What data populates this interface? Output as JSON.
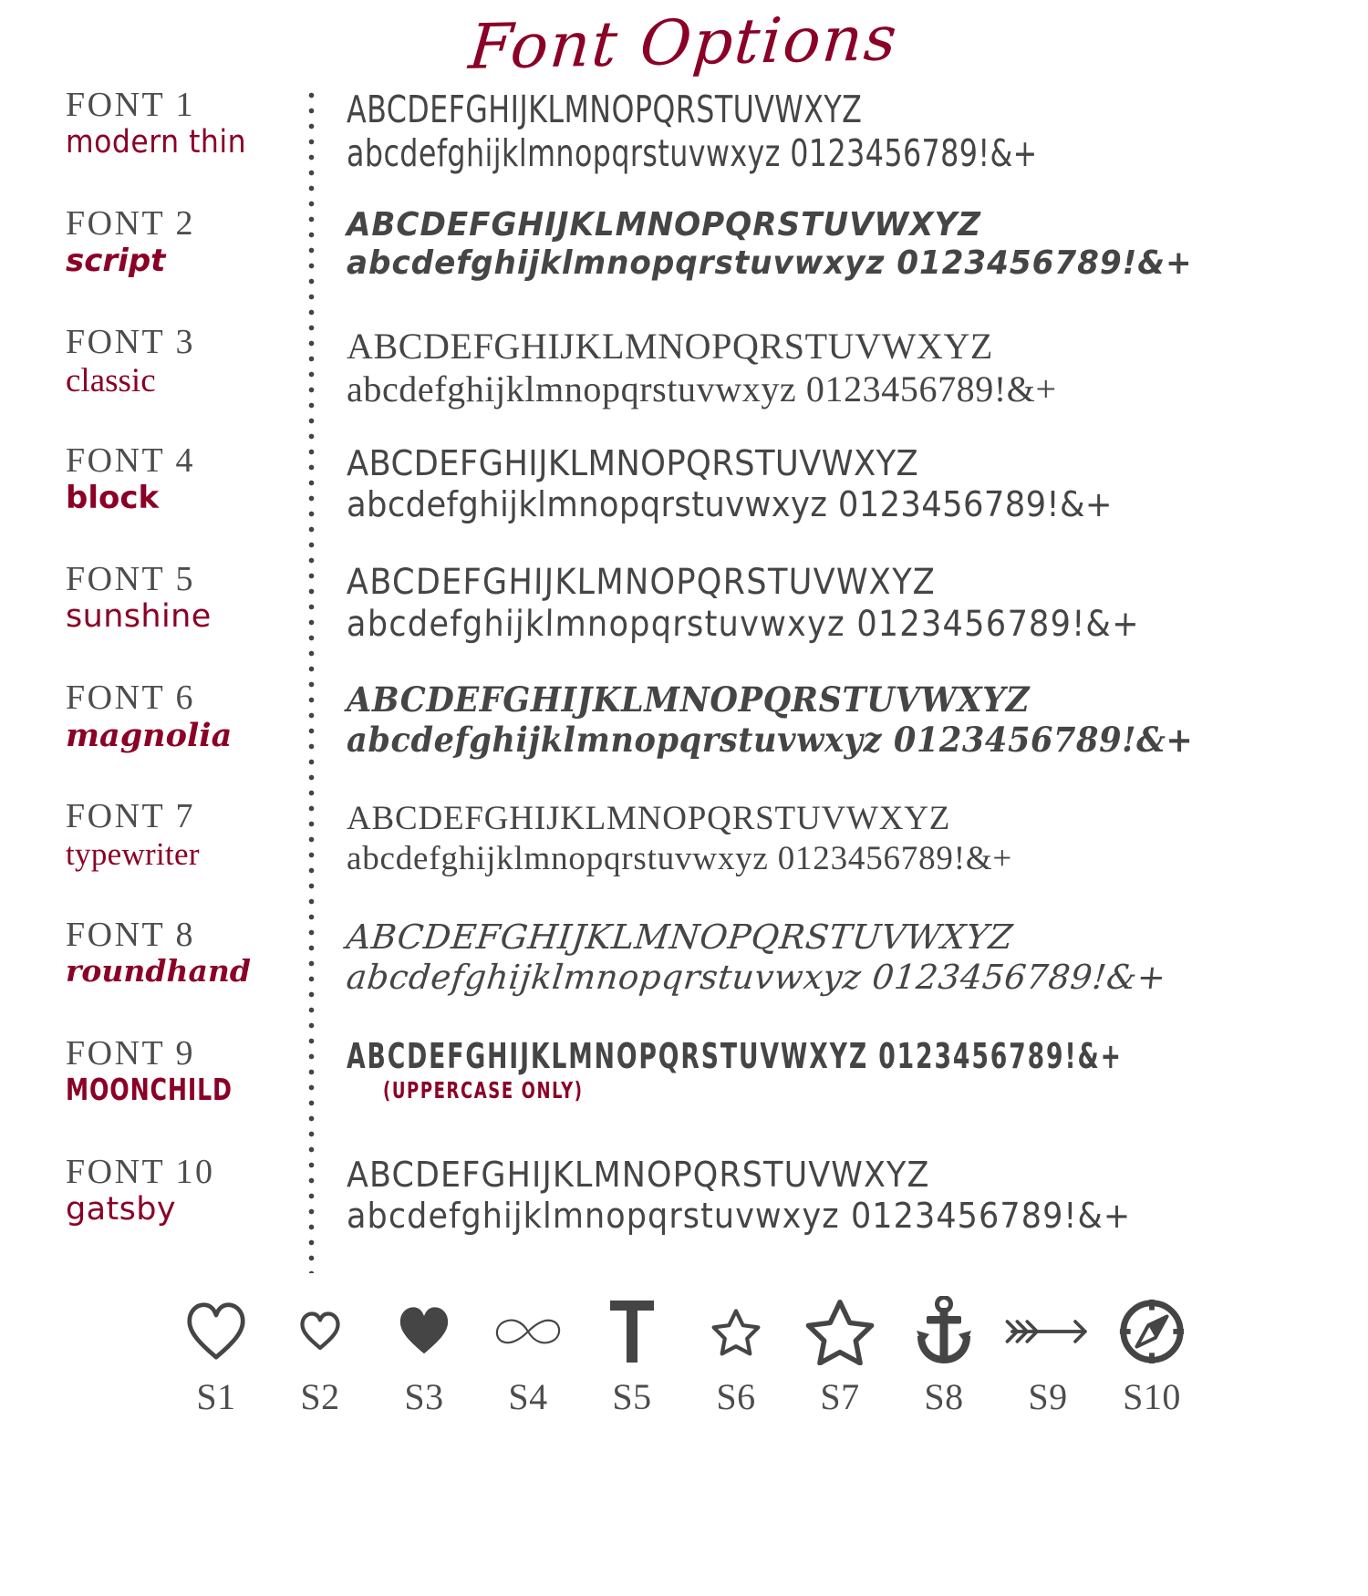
{
  "title": "Font Options",
  "colors": {
    "accent_red": "#8B0026",
    "text_gray": "#454545",
    "label_gray": "#4d4d4d",
    "background": "#ffffff"
  },
  "fonts": [
    {
      "number": "FONT 1",
      "style_name": "modern thin",
      "uppercase": "ABCDEFGHIJKLMNOPQRSTUVWXYZ",
      "lowercase": "abcdefghijklmnopqrstuvwxyz 0123456789!&+",
      "note": ""
    },
    {
      "number": "FONT 2",
      "style_name": "script",
      "uppercase": "ABCDEFGHIJKLMNOPQRSTUVWXYZ",
      "lowercase": "abcdefghijklmnopqrstuvwxyz 0123456789!&+",
      "note": ""
    },
    {
      "number": "FONT 3",
      "style_name": "classic",
      "uppercase": "ABCDEFGHIJKLMNOPQRSTUVWXYZ",
      "lowercase": "abcdefghijklmnopqrstuvwxyz 0123456789!&+",
      "note": ""
    },
    {
      "number": "FONT 4",
      "style_name": "block",
      "uppercase": "ABCDEFGHIJKLMNOPQRSTUVWXYZ",
      "lowercase": "abcdefghijklmnopqrstuvwxyz 0123456789!&+",
      "note": ""
    },
    {
      "number": "FONT 5",
      "style_name": "sunshine",
      "uppercase": "ABCDEFGHIJKLMNOPQRSTUVWXYZ",
      "lowercase": "abcdefghijklmnopqrstuvwxyz 0123456789!&+",
      "note": ""
    },
    {
      "number": "FONT 6",
      "style_name": "magnolia",
      "uppercase": "ABCDEFGHIJKLMNOPQRSTUVWXYZ",
      "lowercase": "abcdefghijklmnopqrstuvwxyz 0123456789!&+",
      "note": ""
    },
    {
      "number": "FONT 7",
      "style_name": "typewriter",
      "uppercase": "ABCDEFGHIJKLMNOPQRSTUVWXYZ",
      "lowercase": "abcdefghijklmnopqrstuvwxyz 0123456789!&+",
      "note": ""
    },
    {
      "number": "FONT 8",
      "style_name": "roundhand",
      "uppercase": "ABCDEFGHIJKLMNOPQRSTUVWXYZ",
      "lowercase": "abcdefghijklmnopqrstuvwxyz 0123456789!&+",
      "note": ""
    },
    {
      "number": "FONT 9",
      "style_name": "MOONCHILD",
      "uppercase": "ABCDEFGHIJKLMNOPQRSTUVWXYZ 0123456789!&+",
      "lowercase": "",
      "note": "(UPPERCASE ONLY)"
    },
    {
      "number": "FONT 10",
      "style_name": "gatsby",
      "uppercase": "ABCDEFGHIJKLMNOPQRSTUVWXYZ",
      "lowercase": "abcdefghijklmnopqrstuvwxyz 0123456789!&+",
      "note": ""
    }
  ],
  "symbols": [
    {
      "label": "S1",
      "icon": "heart-outline-large-icon"
    },
    {
      "label": "S2",
      "icon": "heart-outline-small-icon"
    },
    {
      "label": "S3",
      "icon": "heart-filled-icon"
    },
    {
      "label": "S4",
      "icon": "infinity-icon"
    },
    {
      "label": "S5",
      "icon": "cross-icon"
    },
    {
      "label": "S6",
      "icon": "star-outline-small-icon"
    },
    {
      "label": "S7",
      "icon": "star-outline-large-icon"
    },
    {
      "label": "S8",
      "icon": "anchor-icon"
    },
    {
      "label": "S9",
      "icon": "arrow-feathered-icon"
    },
    {
      "label": "S10",
      "icon": "compass-icon"
    }
  ]
}
